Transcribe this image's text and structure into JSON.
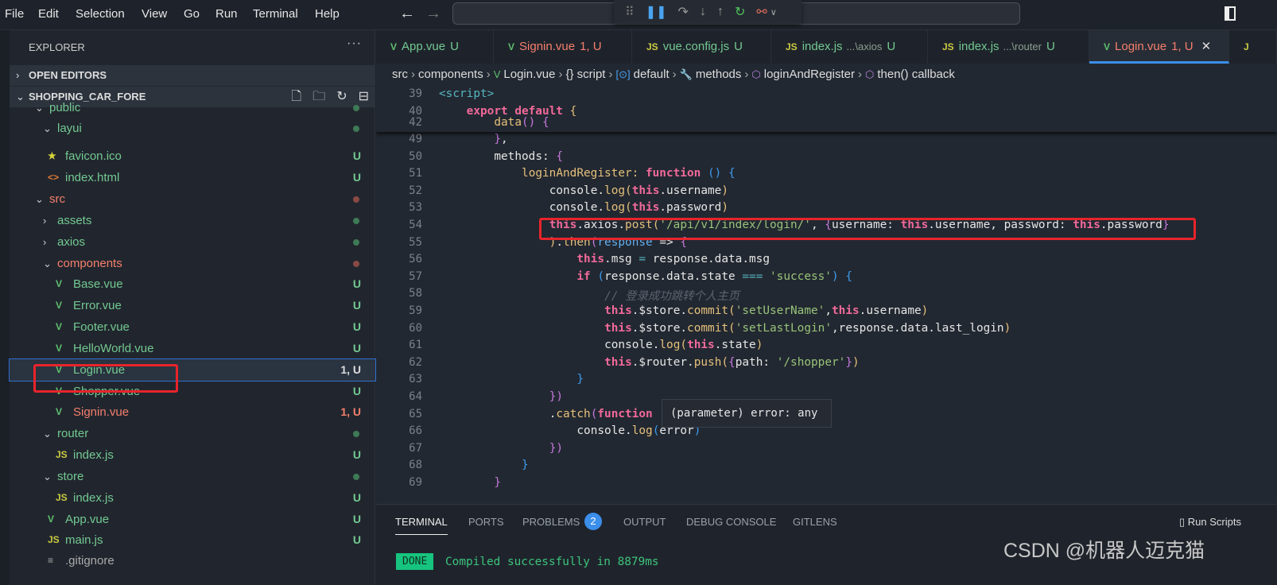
{
  "menu": [
    "File",
    "Edit",
    "Selection",
    "View",
    "Go",
    "Run",
    "Terminal",
    "Help"
  ],
  "debug_toolbar": [
    "grip-icon",
    "pause-icon",
    "step-over-icon",
    "step-into-icon",
    "step-out-icon",
    "restart-icon",
    "disconnect-icon",
    "chevron-down-icon"
  ],
  "explorer": {
    "title": "EXPLORER",
    "more": "···",
    "open_editors": "OPEN EDITORS",
    "project": "SHOPPING_CAR_FORE",
    "items": [
      {
        "label": "public",
        "type": "folder",
        "depth": 1,
        "open": true,
        "status": "dot-green"
      },
      {
        "label": "layui",
        "type": "folder",
        "depth": 2,
        "open": true,
        "status": "dot-green"
      },
      {
        "label": "favicon.ico",
        "type": "star",
        "depth": 2,
        "status": "U"
      },
      {
        "label": "index.html",
        "type": "html",
        "depth": 2,
        "status": "U"
      },
      {
        "label": "src",
        "type": "folder",
        "depth": 1,
        "open": true,
        "status": "dot-red"
      },
      {
        "label": "assets",
        "type": "folder",
        "depth": 2,
        "open": false,
        "status": "dot-green"
      },
      {
        "label": "axios",
        "type": "folder",
        "depth": 2,
        "open": false,
        "status": "dot-green"
      },
      {
        "label": "components",
        "type": "folder",
        "depth": 2,
        "open": true,
        "status": "dot-red"
      },
      {
        "label": "Base.vue",
        "type": "vue",
        "depth": 3,
        "status": "U"
      },
      {
        "label": "Error.vue",
        "type": "vue",
        "depth": 3,
        "status": "U"
      },
      {
        "label": "Footer.vue",
        "type": "vue",
        "depth": 3,
        "status": "U"
      },
      {
        "label": "HelloWorld.vue",
        "type": "vue",
        "depth": 3,
        "status": "U"
      },
      {
        "label": "Login.vue",
        "type": "vue",
        "depth": 3,
        "status": "1, U",
        "selected": true
      },
      {
        "label": "Shopper.vue",
        "type": "vue",
        "depth": 3,
        "status": "U"
      },
      {
        "label": "Signin.vue",
        "type": "vue",
        "depth": 3,
        "status": "1, U",
        "error": true
      },
      {
        "label": "router",
        "type": "folder",
        "depth": 2,
        "open": true,
        "status": "dot-green"
      },
      {
        "label": "index.js",
        "type": "js",
        "depth": 3,
        "status": "U"
      },
      {
        "label": "store",
        "type": "folder",
        "depth": 2,
        "open": true,
        "status": "dot-green"
      },
      {
        "label": "index.js",
        "type": "js",
        "depth": 3,
        "status": "U"
      },
      {
        "label": "App.vue",
        "type": "vue",
        "depth": 2,
        "status": "U"
      },
      {
        "label": "main.js",
        "type": "js",
        "depth": 2,
        "status": "U"
      },
      {
        "label": ".gitignore",
        "type": "git",
        "depth": 2,
        "status": ""
      }
    ]
  },
  "tabs": [
    {
      "icon": "vue",
      "name": "App.vue",
      "status": "U"
    },
    {
      "icon": "vue",
      "name": "Signin.vue",
      "status": "1, U",
      "error": true
    },
    {
      "icon": "js",
      "name": "vue.config.js",
      "status": "U"
    },
    {
      "icon": "js",
      "name": "index.js",
      "desc": "...\\axios",
      "status": "U"
    },
    {
      "icon": "js",
      "name": "index.js",
      "desc": "...\\router",
      "status": "U"
    },
    {
      "icon": "vue",
      "name": "Login.vue",
      "status": "1, U",
      "error": true,
      "active": true
    }
  ],
  "breadcrumb": [
    "src",
    "components",
    "Login.vue",
    "{} script",
    "default",
    "methods",
    "loginAndRegister",
    "then() callback"
  ],
  "code": {
    "sticky": [
      {
        "n": "39",
        "indent": 0,
        "t": [
          [
            "<script>",
            "t"
          ]
        ]
      },
      {
        "n": "40",
        "indent": 1,
        "t": [
          [
            "export default ",
            "k"
          ],
          [
            "{",
            "b1"
          ]
        ]
      },
      {
        "n": "42",
        "indent": 2,
        "t": [
          [
            "data",
            "f"
          ],
          [
            "() ",
            "b2"
          ],
          [
            "{",
            "b2"
          ]
        ]
      }
    ],
    "lines": [
      {
        "n": "49",
        "indent": 2,
        "t": [
          [
            "}",
            "b2"
          ],
          [
            ",",
            "p"
          ]
        ]
      },
      {
        "n": "50",
        "indent": 2,
        "t": [
          [
            "methods: ",
            "p"
          ],
          [
            "{",
            "b2"
          ]
        ]
      },
      {
        "n": "51",
        "indent": 3,
        "t": [
          [
            "loginAndRegister: ",
            "f"
          ],
          [
            "function ",
            "k"
          ],
          [
            "() ",
            "b3"
          ],
          [
            "{",
            "b3"
          ]
        ]
      },
      {
        "n": "52",
        "indent": 4,
        "t": [
          [
            "console.",
            "p"
          ],
          [
            "log",
            "f"
          ],
          [
            "(",
            "b1"
          ],
          [
            "this",
            "k"
          ],
          [
            ".username",
            "p"
          ],
          [
            ")",
            "b1"
          ]
        ]
      },
      {
        "n": "53",
        "indent": 4,
        "t": [
          [
            "console.",
            "p"
          ],
          [
            "log",
            "f"
          ],
          [
            "(",
            "b1"
          ],
          [
            "this",
            "k"
          ],
          [
            ".password",
            "p"
          ],
          [
            ")",
            "b1"
          ]
        ]
      },
      {
        "n": "54",
        "indent": 4,
        "t": [
          [
            "this",
            "k"
          ],
          [
            ".axios.",
            "p"
          ],
          [
            "post",
            "f"
          ],
          [
            "(",
            "b1"
          ],
          [
            "'/api/v1/index/login/'",
            "s"
          ],
          [
            ", ",
            "p"
          ],
          [
            "{",
            "b2"
          ],
          [
            "username: ",
            "p"
          ],
          [
            "this",
            "k"
          ],
          [
            ".username, password: ",
            "p"
          ],
          [
            "this",
            "k"
          ],
          [
            ".password",
            "p"
          ],
          [
            "}",
            "b2"
          ]
        ]
      },
      {
        "n": "55",
        "indent": 4,
        "t": [
          [
            ")",
            "b1"
          ],
          [
            ".",
            "p"
          ],
          [
            "then",
            "f"
          ],
          [
            "(",
            "b2"
          ],
          [
            "response",
            "pa"
          ],
          [
            " => ",
            "p"
          ],
          [
            "{",
            "b2"
          ]
        ]
      },
      {
        "n": "56",
        "indent": 5,
        "t": [
          [
            "this",
            "k"
          ],
          [
            ".msg ",
            "p"
          ],
          [
            "= ",
            "o"
          ],
          [
            "response.data.msg",
            "p"
          ]
        ]
      },
      {
        "n": "57",
        "indent": 5,
        "t": [
          [
            "if ",
            "k"
          ],
          [
            "(",
            "b3"
          ],
          [
            "response.data.state ",
            "p"
          ],
          [
            "=== ",
            "o"
          ],
          [
            "'success'",
            "s"
          ],
          [
            ") ",
            "b3"
          ],
          [
            "{",
            "b3"
          ]
        ]
      },
      {
        "n": "58",
        "indent": 6,
        "t": [
          [
            "// 登录成功跳转个人主页",
            "c"
          ]
        ]
      },
      {
        "n": "59",
        "indent": 6,
        "t": [
          [
            "this",
            "k"
          ],
          [
            ".$store.",
            "p"
          ],
          [
            "commit",
            "f"
          ],
          [
            "(",
            "b1"
          ],
          [
            "'setUserName'",
            "s"
          ],
          [
            ",",
            "p"
          ],
          [
            "this",
            "k"
          ],
          [
            ".username",
            "p"
          ],
          [
            ")",
            "b1"
          ]
        ]
      },
      {
        "n": "60",
        "indent": 6,
        "t": [
          [
            "this",
            "k"
          ],
          [
            ".$store.",
            "p"
          ],
          [
            "commit",
            "f"
          ],
          [
            "(",
            "b1"
          ],
          [
            "'setLastLogin'",
            "s"
          ],
          [
            ",response.data.last_login",
            "p"
          ],
          [
            ")",
            "b1"
          ]
        ]
      },
      {
        "n": "61",
        "indent": 6,
        "t": [
          [
            "console.",
            "p"
          ],
          [
            "log",
            "f"
          ],
          [
            "(",
            "b1"
          ],
          [
            "this",
            "k"
          ],
          [
            ".state",
            "p"
          ],
          [
            ")",
            "b1"
          ]
        ]
      },
      {
        "n": "62",
        "indent": 6,
        "t": [
          [
            "this",
            "k"
          ],
          [
            ".$router.",
            "p"
          ],
          [
            "push",
            "f"
          ],
          [
            "(",
            "b1"
          ],
          [
            "{",
            "b2"
          ],
          [
            "path: ",
            "p"
          ],
          [
            "'/shopper'",
            "s"
          ],
          [
            "}",
            "b2"
          ],
          [
            ")",
            "b1"
          ]
        ]
      },
      {
        "n": "63",
        "indent": 5,
        "t": [
          [
            "}",
            "b3"
          ]
        ]
      },
      {
        "n": "64",
        "indent": 4,
        "t": [
          [
            "}",
            "b2"
          ],
          [
            ")",
            "b2"
          ]
        ]
      },
      {
        "n": "65",
        "indent": 4,
        "t": [
          [
            ".",
            "p"
          ],
          [
            "catch",
            "f"
          ],
          [
            "(",
            "b2"
          ],
          [
            "function ",
            "k"
          ]
        ]
      },
      {
        "n": "66",
        "indent": 5,
        "t": [
          [
            "console.",
            "p"
          ],
          [
            "log",
            "f"
          ],
          [
            "(",
            "b3"
          ],
          [
            "error",
            "p"
          ],
          [
            ")",
            "b3"
          ]
        ]
      },
      {
        "n": "67",
        "indent": 4,
        "t": [
          [
            "}",
            "b2"
          ],
          [
            ")",
            "b2"
          ]
        ]
      },
      {
        "n": "68",
        "indent": 3,
        "t": [
          [
            "}",
            "b3"
          ]
        ]
      },
      {
        "n": "69",
        "indent": 2,
        "t": [
          [
            "}",
            "b2"
          ]
        ]
      }
    ]
  },
  "hover_tooltip": "(parameter) error: any",
  "panel": {
    "tabs": [
      "TERMINAL",
      "PORTS",
      "PROBLEMS",
      "OUTPUT",
      "DEBUG CONSOLE",
      "GITLENS"
    ],
    "problems_count": "2",
    "run_scripts": "Run Scripts",
    "done": "DONE",
    "message": "Compiled successfully in 8879ms"
  },
  "watermark": "CSDN @机器人迈克猫",
  "colors": {
    "accent": "#3b8eea",
    "untracked": "#73c991",
    "error": "#f57f6c",
    "highlight_box": "#e8242b"
  }
}
